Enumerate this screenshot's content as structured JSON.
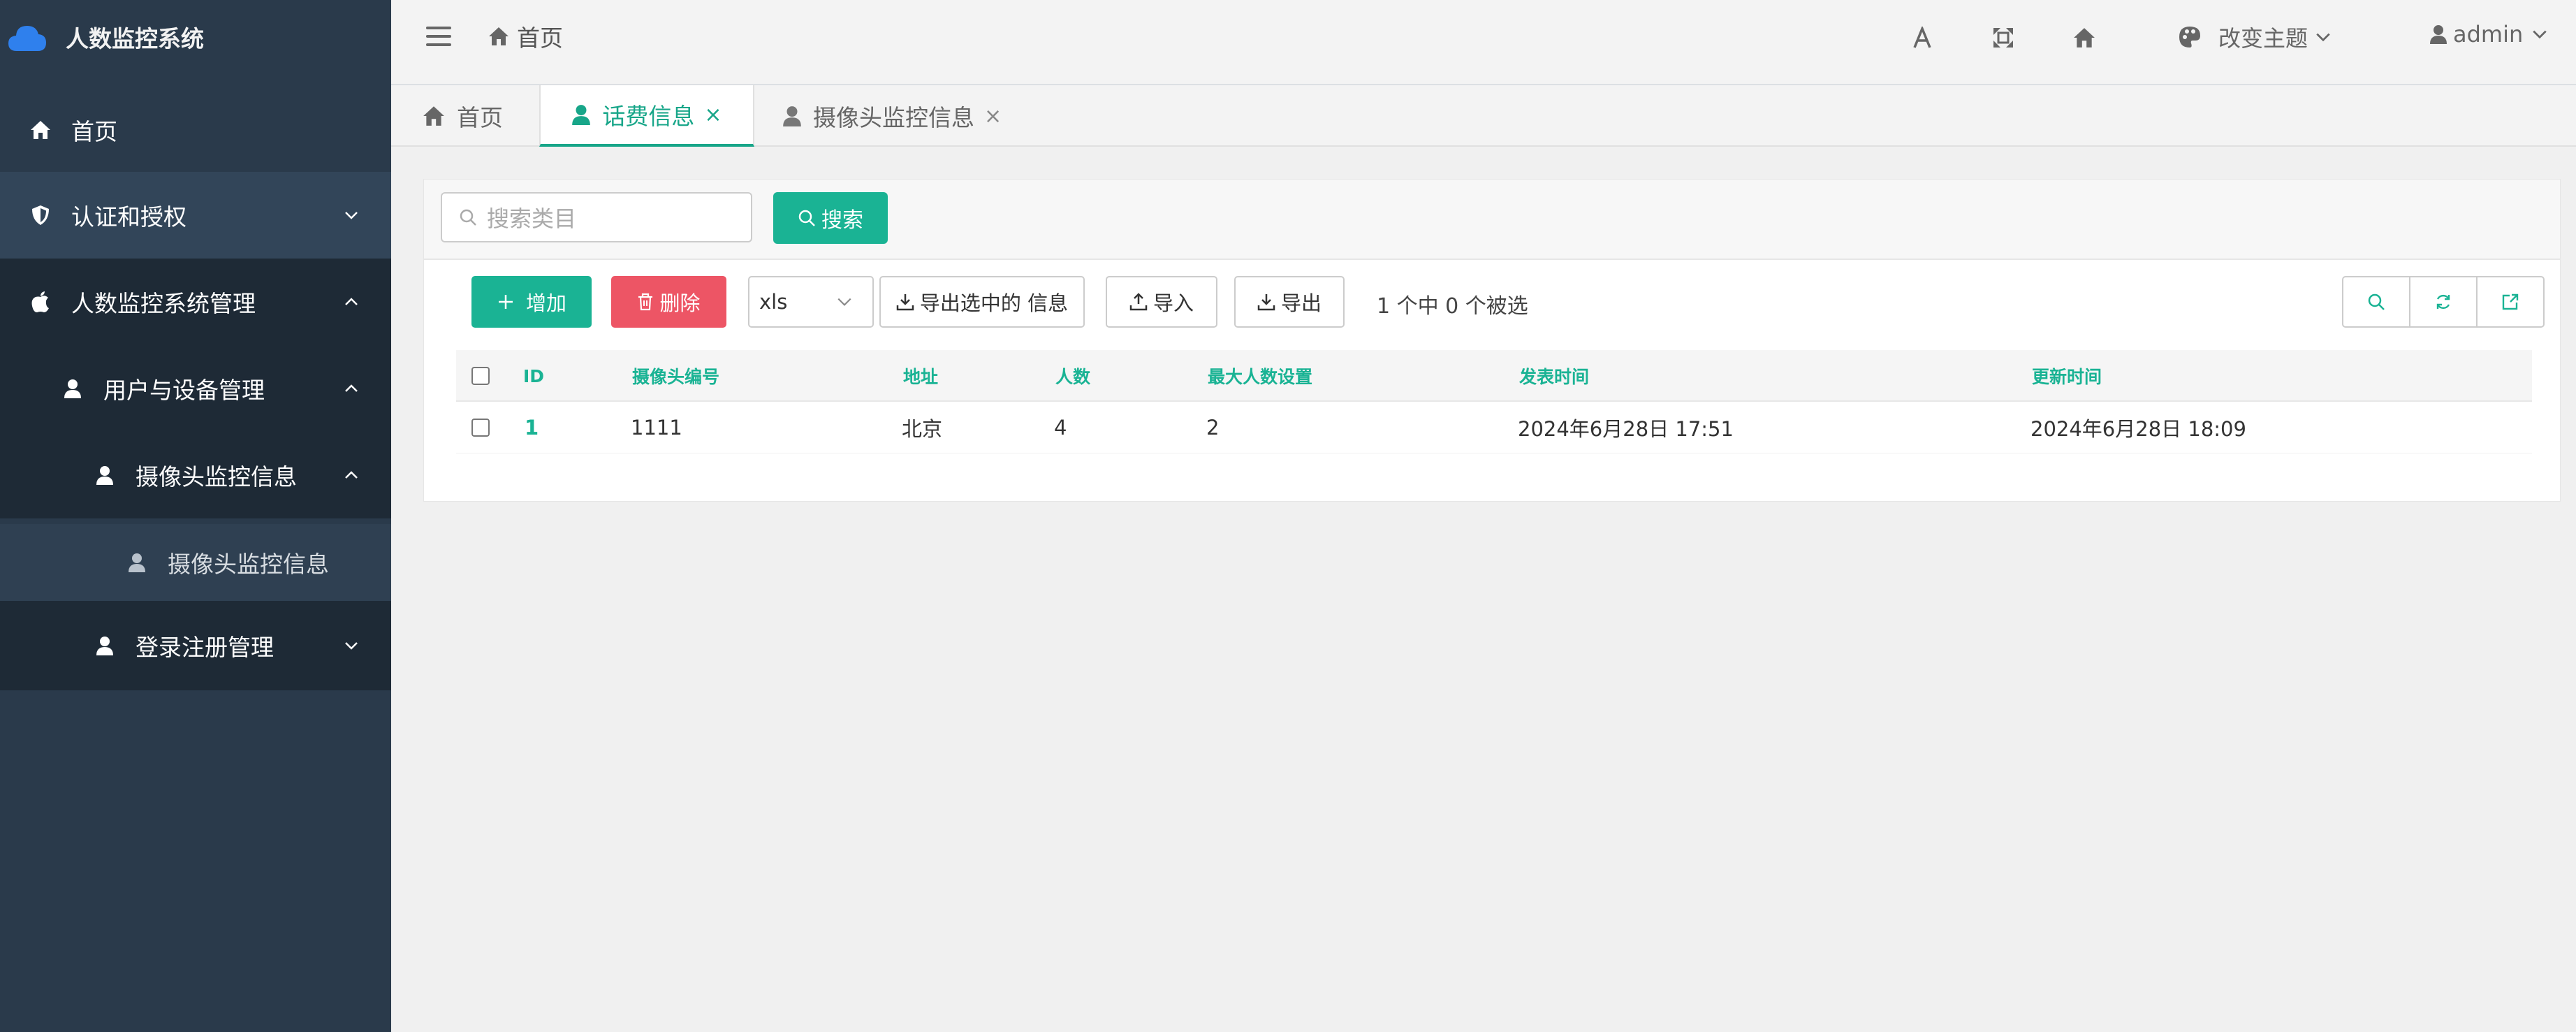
{
  "app": {
    "title": "人数监控系统"
  },
  "sidebar": {
    "items": [
      {
        "label": "首页"
      },
      {
        "label": "认证和授权"
      },
      {
        "label": "人数监控系统管理"
      },
      {
        "label": "用户与设备管理"
      },
      {
        "label": "摄像头监控信息"
      },
      {
        "label": "摄像头监控信息"
      },
      {
        "label": "登录注册管理"
      }
    ]
  },
  "header": {
    "breadcrumb": "首页",
    "theme_label": "改变主题",
    "user_label": "admin",
    "icons": [
      "font-size-icon",
      "fullscreen-icon",
      "home-icon",
      "palette-icon",
      "user-icon"
    ]
  },
  "tabs": [
    {
      "label": "首页",
      "active": false
    },
    {
      "label": "话费信息",
      "active": true,
      "close": "×"
    },
    {
      "label": "摄像头监控信息",
      "active": false,
      "close": "×"
    }
  ],
  "search": {
    "placeholder": "搜索类目",
    "button_label": "搜索"
  },
  "toolbar": {
    "add_label": "增加",
    "delete_label": "删除",
    "format_value": "xls",
    "export_selected_label": "导出选中的 信息",
    "import_label": "导入",
    "export_label": "导出",
    "selection_status": "1 个中 0 个被选"
  },
  "table": {
    "columns": [
      "ID",
      "摄像头编号",
      "地址",
      "人数",
      "最大人数设置",
      "发表时间",
      "更新时间"
    ],
    "rows": [
      [
        "1",
        "1111",
        "北京",
        "4",
        "2",
        "2024年6月28日 17:51",
        "2024年6月28日 18:09"
      ]
    ]
  },
  "colors": {
    "accent": "#1ab394",
    "danger": "#ed5565",
    "sidebar_bg": "#2a3a4b"
  }
}
